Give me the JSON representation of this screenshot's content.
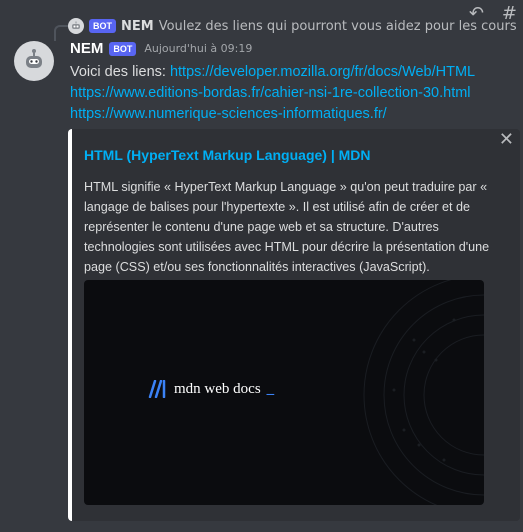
{
  "reply": {
    "bot_tag": "BOT",
    "author": "NEM",
    "text": "Voulez des liens qui pourront vous aidez pour les cours"
  },
  "message": {
    "author": "NEM",
    "bot_tag": "BOT",
    "timestamp": "Aujourd'hui à 09:19",
    "intro": "Voici des liens:",
    "links": [
      "https://developer.mozilla.org/fr/docs/Web/HTML",
      "https://www.editions-bordas.fr/cahier-nsi-1re-collection-30.html",
      "https://www.numerique-sciences-informatiques.fr/"
    ]
  },
  "embed": {
    "title": "HTML (HyperText Markup Language) | MDN",
    "description": "HTML signifie « HyperText Markup Language » qu'on peut traduire par « langage de balises pour l'hypertexte ». Il est utilisé afin de créer et de représenter le contenu d'une page web et sa structure. D'autres technologies sont utilisées avec HTML pour décrire la présentation d'une page (CSS) et/ou ses fonctionnalités interactives (JavaScript).",
    "close_symbol": "✕",
    "image_logo_text": "mdn web docs",
    "image_logo_underscore": "_",
    "accent_color": "#ffffff"
  },
  "colors": {
    "background": "#36393f",
    "link": "#00aff4",
    "bot_tag": "#5865f2"
  },
  "toolbar": {
    "reply_icon": "↶",
    "thread_icon": "#"
  }
}
